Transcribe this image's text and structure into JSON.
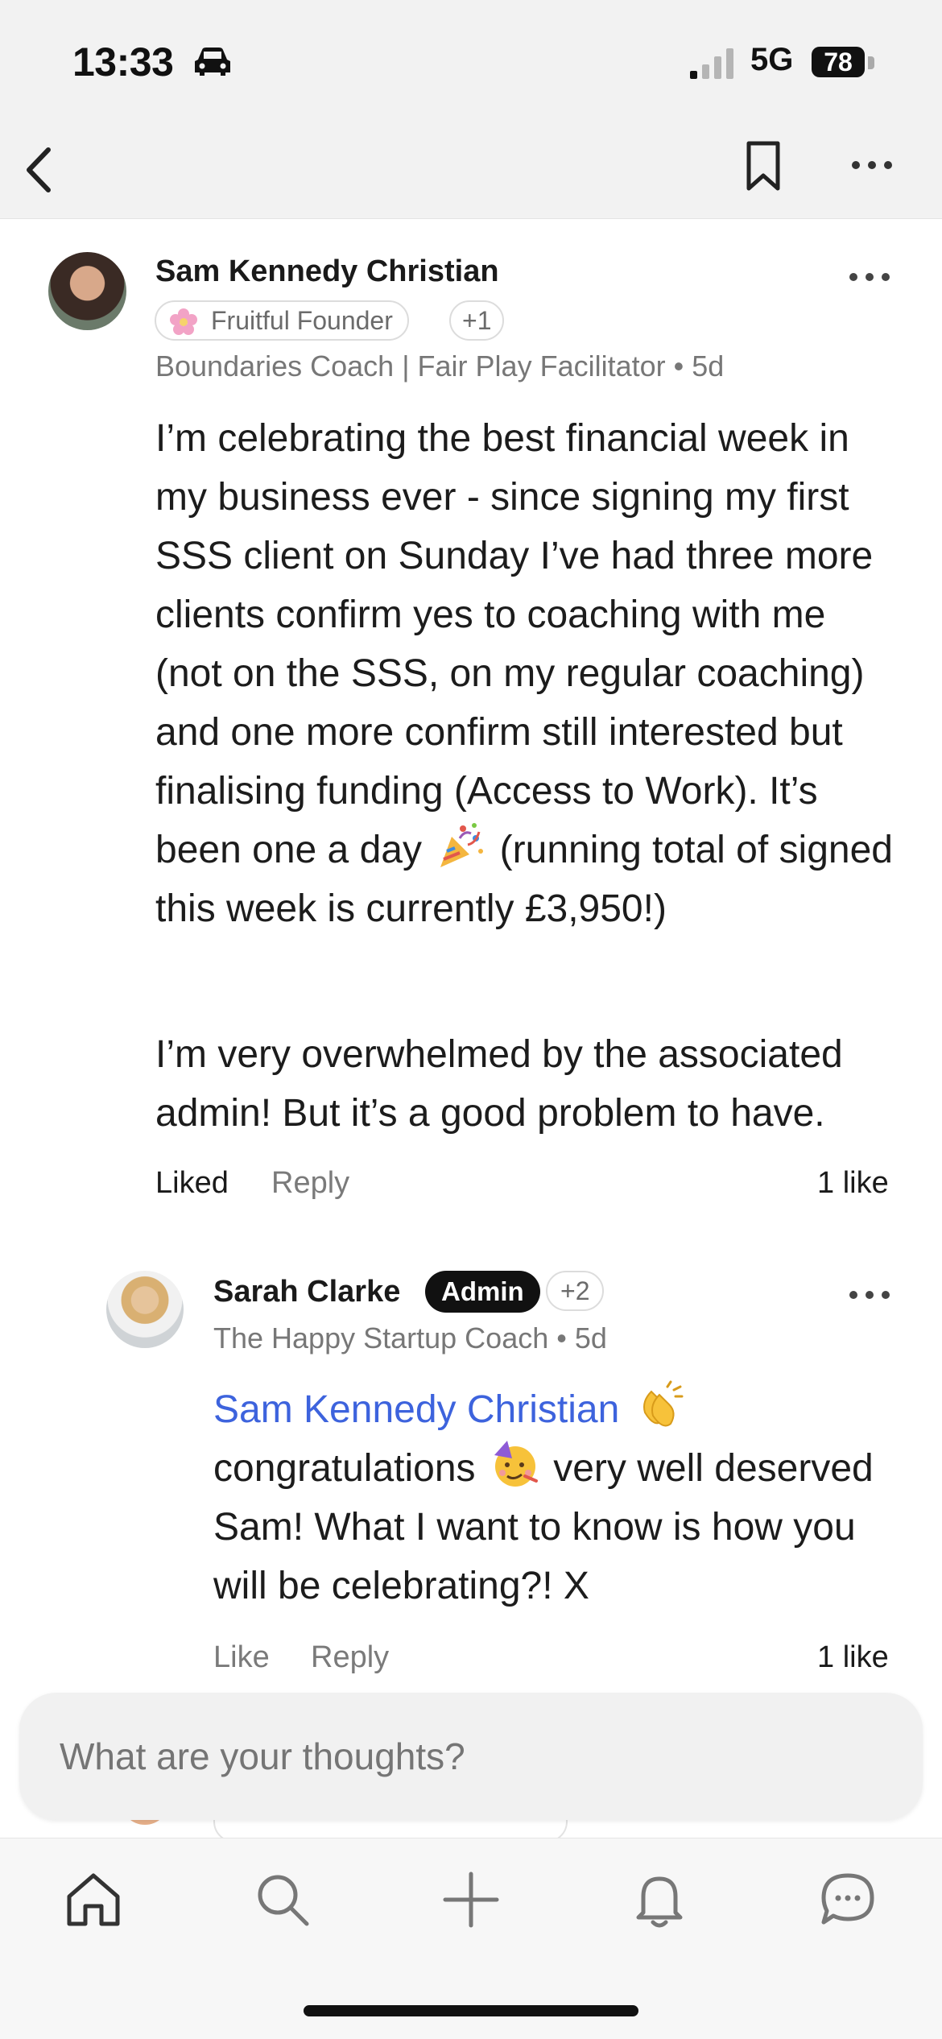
{
  "status_bar": {
    "time": "13:33",
    "network": "5G",
    "battery": "78"
  },
  "nav": {
    "back_icon": "chevron-left-icon",
    "bookmark_icon": "bookmark-icon",
    "more_icon": "more-icon"
  },
  "post": {
    "author": "Sam Kennedy Christian",
    "badge": "Fruitful Founder",
    "badge_extra": "+1",
    "headline": "Boundaries Coach | Fair Play Facilitator",
    "age": "5d",
    "paragraph1_part1": "I’m celebrating the best financial week in my business ever - since signing my first SSS client on Sunday I’ve had three more clients confirm yes to coaching with me (not on the SSS, on my regular coaching) and one more confirm still interested but finalising funding (Access to Work). It’s been one a day",
    "paragraph1_part2": "(running total of signed this week is currently £3,950!)",
    "paragraph2": "I’m very overwhelmed by the associated admin! But it’s a good problem to have.",
    "liked_label": "Liked",
    "reply_label": "Reply",
    "likes": "1 like"
  },
  "reply": {
    "author": "Sarah Clarke",
    "role_badge": "Admin",
    "badge_extra": "+2",
    "headline": "The Happy Startup Coach",
    "age": "5d",
    "mention": "Sam Kennedy Christian",
    "text_part1": "congratulations",
    "text_part2": "very well deserved Sam! What I want to know is how you will be celebrating?! X",
    "like_label": "Like",
    "reply_label": "Reply",
    "likes": "1 like"
  },
  "composer": {
    "placeholder": "What are your thoughts?"
  },
  "tabs": [
    "home-icon",
    "search-icon",
    "plus-icon",
    "bell-icon",
    "chat-icon"
  ],
  "colors": {
    "mention": "#3d63dd",
    "admin_badge": "#111111"
  }
}
